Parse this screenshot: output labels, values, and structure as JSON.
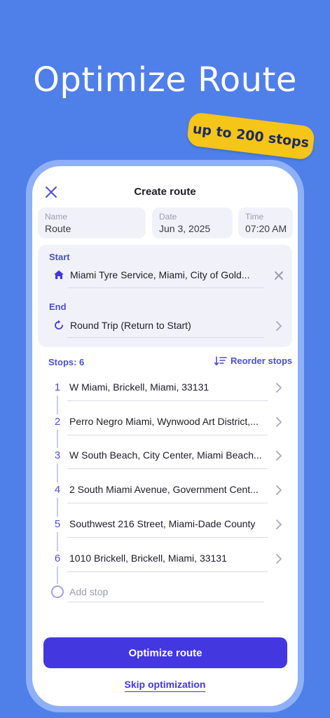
{
  "headline": "Optimize Route",
  "badge": "up to 200 stops",
  "screen": {
    "title": "Create route",
    "fields": {
      "name": {
        "label": "Name",
        "value": "Route"
      },
      "date": {
        "label": "Date",
        "value": "Jun 3, 2025"
      },
      "time": {
        "label": "Time",
        "value": "07:20 AM"
      }
    },
    "start": {
      "label": "Start",
      "value": "Miami Tyre Service, Miami, City of Gold..."
    },
    "end": {
      "label": "End",
      "value": "Round Trip (Return to Start)"
    },
    "stops_label": "Stops: 6",
    "reorder_label": "Reorder stops",
    "stops": [
      {
        "num": "1",
        "address": "W Miami, Brickell, Miami, 33131"
      },
      {
        "num": "2",
        "address": "Perro Negro Miami, Wynwood Art District,..."
      },
      {
        "num": "3",
        "address": "W South Beach, City Center, Miami Beach..."
      },
      {
        "num": "4",
        "address": "2 South Miami Avenue, Government Cent..."
      },
      {
        "num": "5",
        "address": "Southwest 216 Street, Miami-Dade County"
      },
      {
        "num": "6",
        "address": "1010 Brickell, Brickell, Miami, 33131"
      }
    ],
    "add_stop": "Add stop",
    "optimize_button": "Optimize route",
    "skip_link": "Skip optimization"
  },
  "icons": {
    "close": "close-icon",
    "start": "home-icon",
    "end": "round-trip-icon",
    "reorder": "sort-icon",
    "row": "chevron-right-icon"
  },
  "colors": {
    "background": "#4f7fe9",
    "accent": "#4338e0",
    "badge": "#f5c518",
    "card": "#f1f2f9"
  }
}
